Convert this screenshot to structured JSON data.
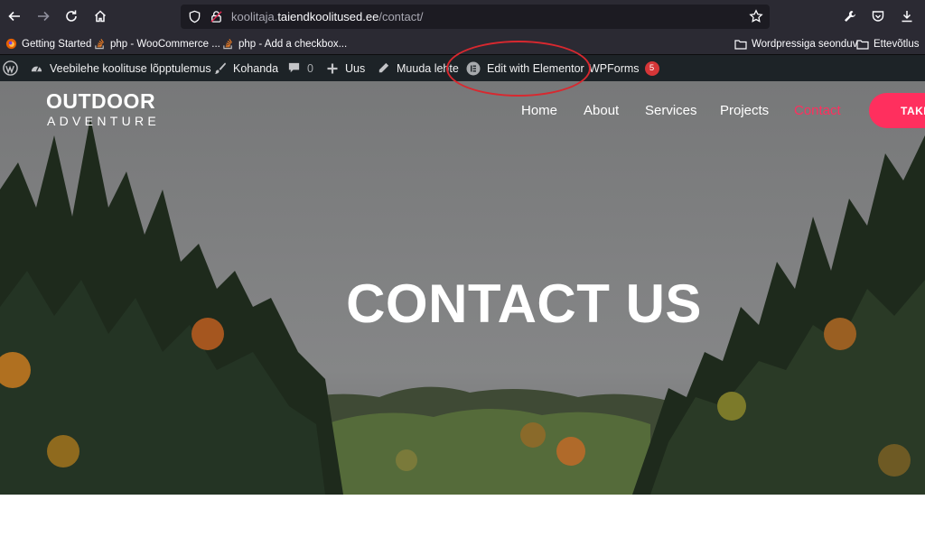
{
  "browser": {
    "url_prefix": "koolitaja.",
    "url_domain": "taiendkoolitused.ee",
    "url_path": "/contact/",
    "bookmarks": [
      {
        "label": "Getting Started"
      },
      {
        "label": "php - WooCommerce ..."
      },
      {
        "label": "php - Add a checkbox..."
      },
      {
        "label": "Wordpressiga seonduv"
      },
      {
        "label": "Ettevõtlus"
      }
    ],
    "icons": [
      "back-icon",
      "forward-icon",
      "reload-icon",
      "home-icon",
      "shield-icon",
      "lock-icon",
      "star-icon",
      "wrench-icon",
      "pocket-icon",
      "download-icon",
      "folder-icon"
    ]
  },
  "adminbar": {
    "site_name": "Veebilehe koolituse lõpptulemus",
    "customize": "Kohanda",
    "comments_count": "0",
    "new": "Uus",
    "edit_page": "Muuda lehte",
    "elementor": "Edit with Elementor",
    "wpforms": "WPForms",
    "wpforms_badge": "5"
  },
  "site": {
    "logo_line1": "OUTDOOR",
    "logo_line2": "ADVENTURE",
    "menu": [
      {
        "label": "Home"
      },
      {
        "label": "About"
      },
      {
        "label": "Services"
      },
      {
        "label": "Projects"
      },
      {
        "label": "Contact"
      }
    ],
    "cta_label": "TAKE",
    "hero_title": "CONTACT US"
  },
  "colors": {
    "accent": "#ff2f5e",
    "annotation": "#d8282f",
    "adminbar": "#1d2327",
    "browser": "#2b2a33"
  }
}
